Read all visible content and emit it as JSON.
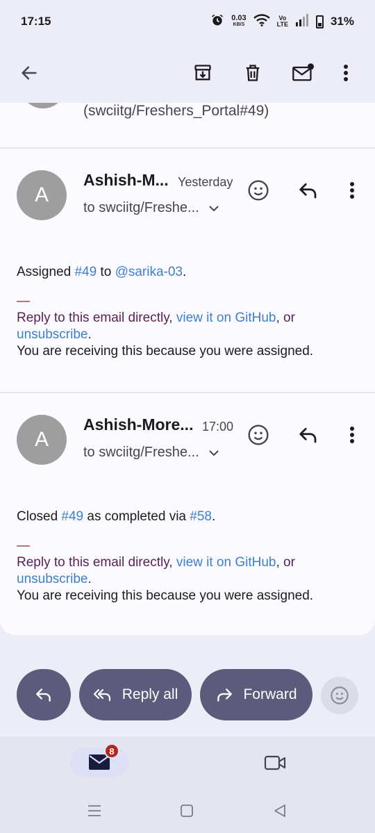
{
  "status_bar": {
    "time": "17:15",
    "net_speed": "0.03",
    "net_unit": "KB/S",
    "volte_top": "Vo",
    "volte_bottom": "LTE",
    "battery": "31%"
  },
  "toolbar": {
    "icons": [
      "back-arrow-icon",
      "archive-icon",
      "delete-icon",
      "mark-unread-icon",
      "more-vert-icon"
    ]
  },
  "collapsed_message": {
    "subject_tail": "(swciitg/Freshers_Portal#49)"
  },
  "messages": [
    {
      "avatar_letter": "A",
      "sender": "Ashish-M...",
      "time": "Yesterday",
      "to": "to swciitg/Freshe...",
      "body": {
        "prefix": "Assigned ",
        "issue_link": "#49",
        "middle": " to ",
        "second_link": "@sarika-03",
        "suffix": "."
      },
      "footer": {
        "dash": "—",
        "reply_text": "Reply to this email directly, ",
        "view_link": "view it on GitHub",
        "or_text": ", or",
        "unsubscribe_link": "unsubscribe",
        "after_unsubscribe": ".",
        "reason": "You are receiving this because you were assigned."
      }
    },
    {
      "avatar_letter": "A",
      "sender": "Ashish-More...",
      "time": "17:00",
      "to": "to swciitg/Freshe...",
      "body": {
        "prefix": "Closed ",
        "issue_link": "#49",
        "middle": " as completed via ",
        "second_link": "#58",
        "suffix": "."
      },
      "footer": {
        "dash": "—",
        "reply_text": "Reply to this email directly, ",
        "view_link": "view it on GitHub",
        "or_text": ", or",
        "unsubscribe_link": "unsubscribe",
        "after_unsubscribe": ".",
        "reason": "You are receiving this because you were assigned."
      }
    }
  ],
  "actions": {
    "reply_all": "Reply all",
    "forward": "Forward"
  },
  "bottom_nav": {
    "mail_badge": "8"
  },
  "colors": {
    "accent_pill": "#5c5b7c",
    "link": "#3f7fcf",
    "footer_purple": "#5a1f54",
    "badge": "#b3261e"
  }
}
